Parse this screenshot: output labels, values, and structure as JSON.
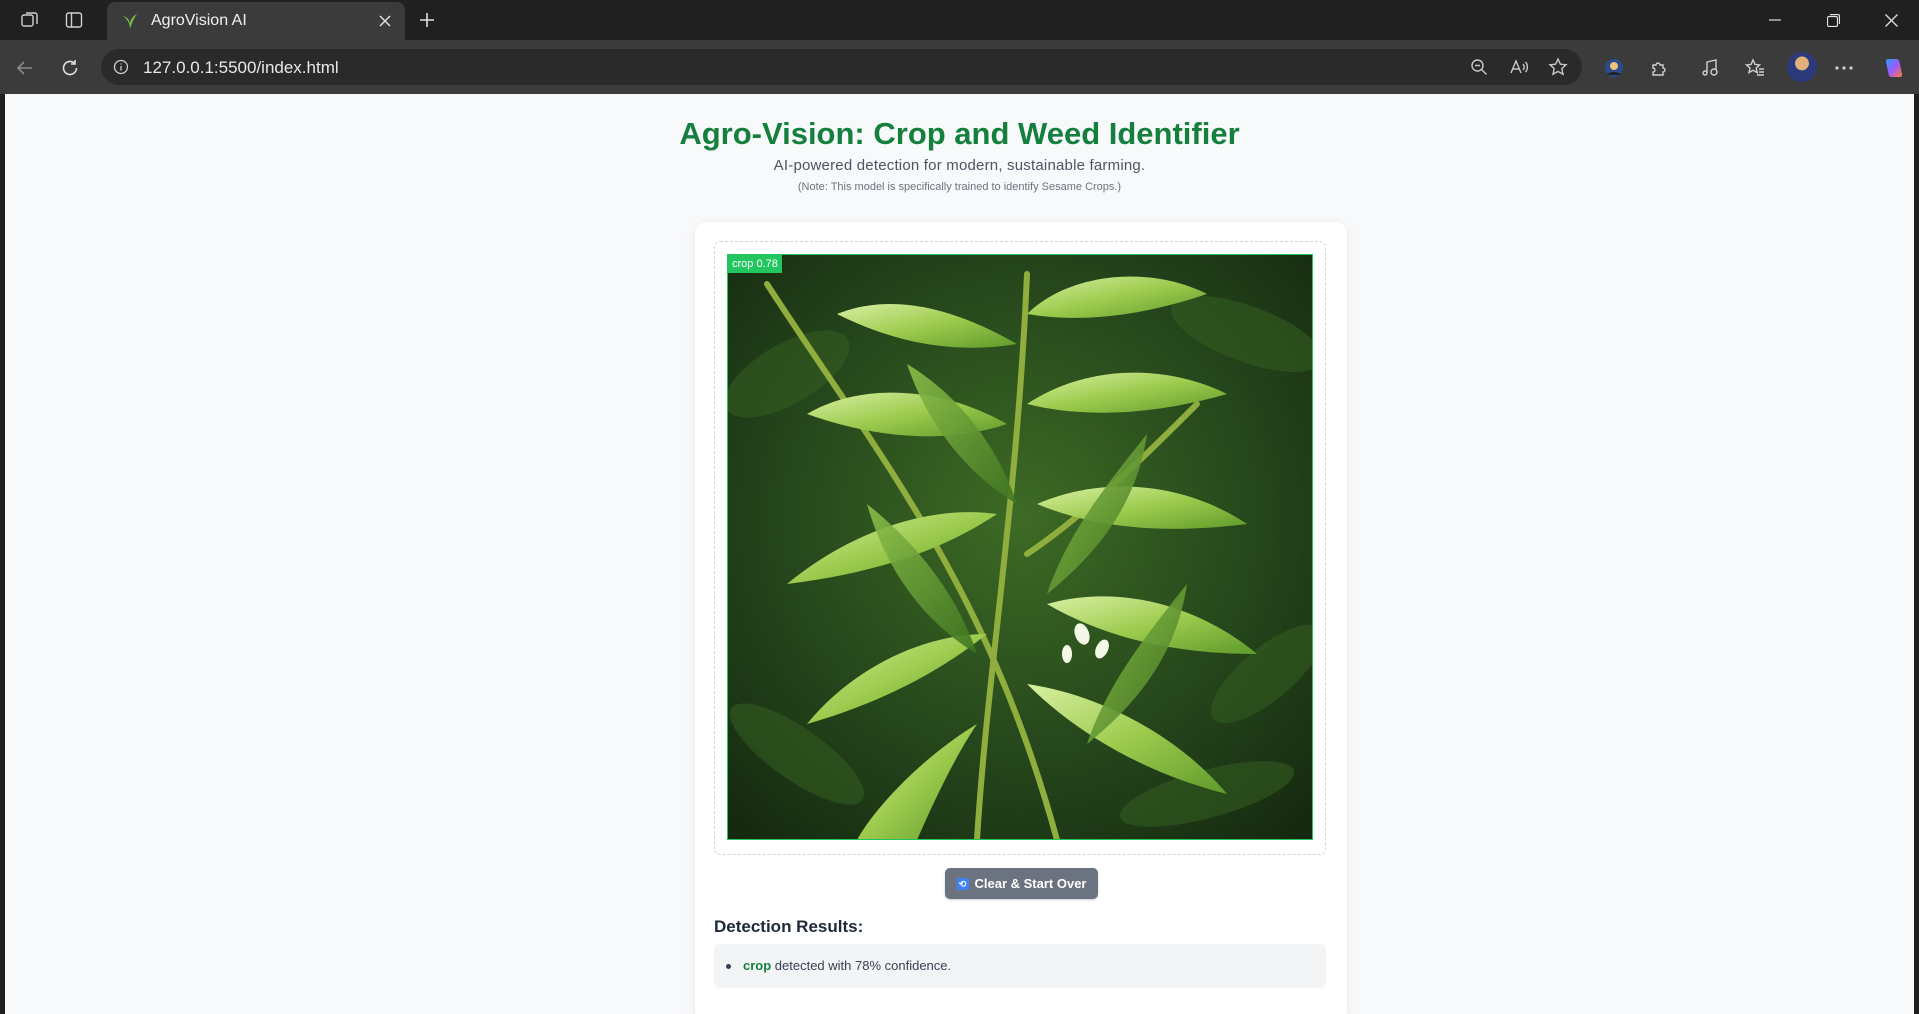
{
  "browser": {
    "tab_title": "AgroVision AI",
    "url": "127.0.0.1:5500/index.html",
    "icons": {
      "workspaces": "workspaces-icon",
      "vertical_tabs": "vertical-tabs-icon",
      "favicon": "leaf-icon",
      "close": "close-icon",
      "new_tab": "plus-icon",
      "back": "back-arrow-icon",
      "refresh": "refresh-icon",
      "info": "info-icon",
      "zoom": "zoom-out-icon",
      "read_aloud": "read-aloud-icon",
      "favorite": "star-icon",
      "extensions": "puzzle-icon",
      "more": "more-icon",
      "copilot": "copilot-icon"
    }
  },
  "page": {
    "title": "Agro-Vision: Crop and Weed Identifier",
    "subtitle": "AI-powered detection for modern, sustainable farming.",
    "note": "(Note: This model is specifically trained to identify Sesame Crops.)"
  },
  "detection": {
    "box_label": "crop 0.78",
    "clear_button": "Clear & Start Over",
    "results_heading": "Detection Results:",
    "results": [
      {
        "label": "crop",
        "text": " detected with 78% confidence."
      }
    ]
  },
  "colors": {
    "brand_green": "#15803d",
    "bbox_green": "#22c55e",
    "button_gray": "#6b7280"
  }
}
